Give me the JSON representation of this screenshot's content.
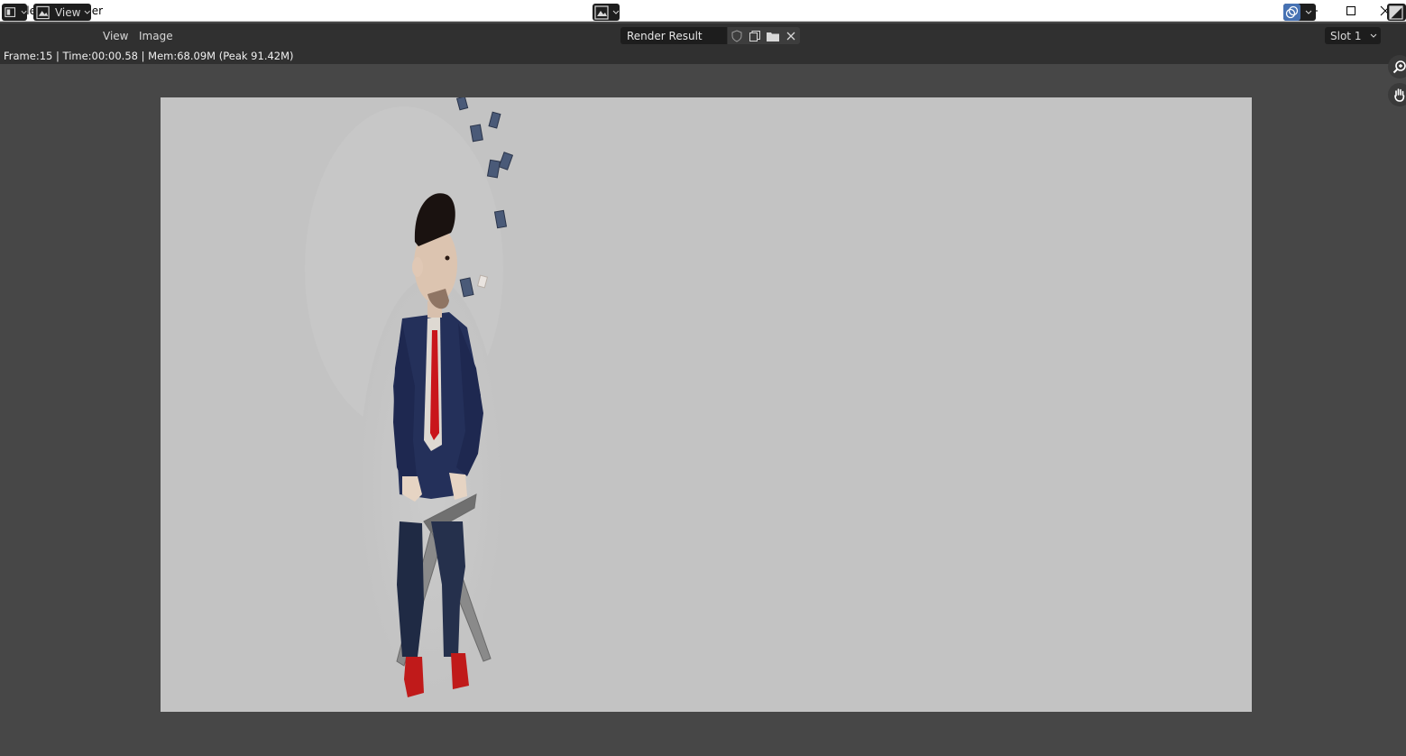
{
  "window": {
    "title": "Blender Render"
  },
  "header": {
    "view_menu_label": "View",
    "menus": [
      "View",
      "Image"
    ],
    "image_name": "Render Result",
    "slot_label": "Slot 1"
  },
  "info": {
    "text": "Frame:15 | Time:00:00.58 | Mem:68.09M (Peak 91.42M)"
  },
  "colors": {
    "background": "#474747",
    "header": "#303030",
    "render_bg": "#c3c3c3",
    "accent": "#4772b3"
  },
  "icons": [
    "blender-logo-icon",
    "minimize-icon",
    "maximize-icon",
    "close-icon",
    "editor-type-icon",
    "image-view-icon",
    "browse-image-icon",
    "fake-user-shield-icon",
    "duplicate-icon",
    "open-folder-icon",
    "unlink-x-icon",
    "overlay-icon",
    "display-channels-icon",
    "zoom-icon",
    "hand-pan-icon"
  ]
}
